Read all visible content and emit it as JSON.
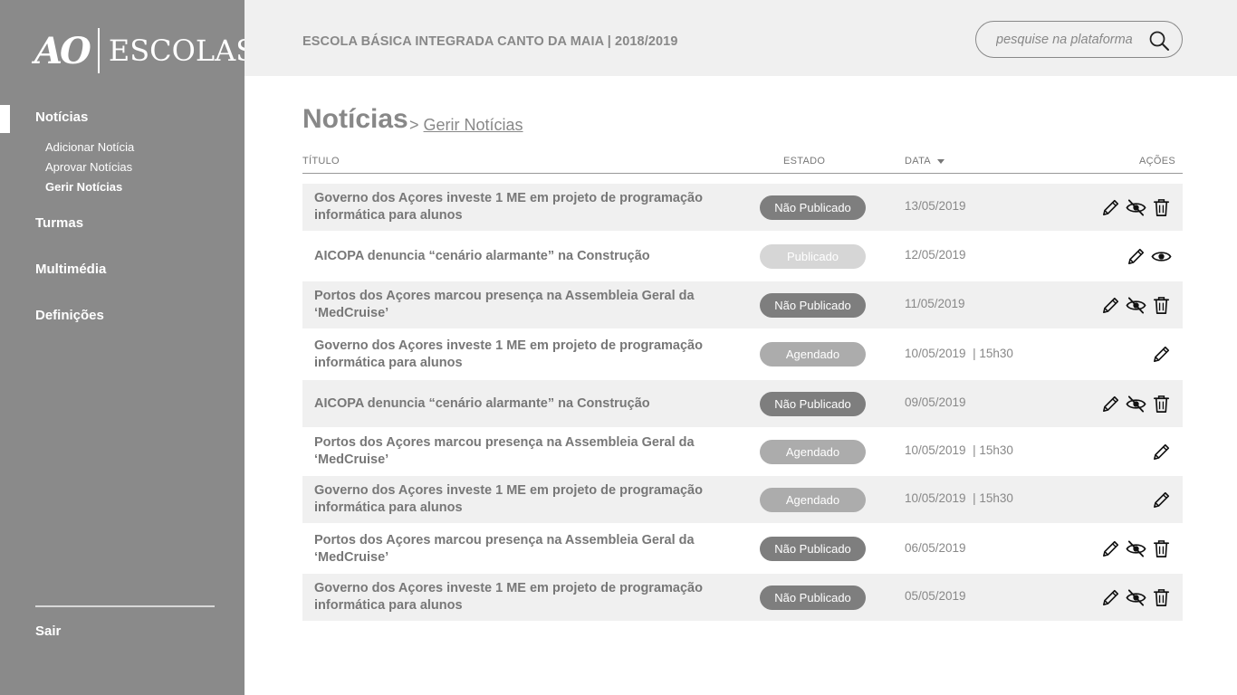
{
  "sidebar": {
    "logo_left": "AO",
    "logo_right": "ESCOLAS",
    "sections": [
      {
        "label": "Notícias"
      },
      {
        "label": "Turmas"
      },
      {
        "label": "Multimédia"
      },
      {
        "label": "Definições"
      }
    ],
    "subitems": [
      {
        "label": "Adicionar Notícia"
      },
      {
        "label": "Aprovar Notícias"
      },
      {
        "label": "Gerir Notícias"
      }
    ],
    "logout": "Sair"
  },
  "header": {
    "school": "ESCOLA BÁSICA INTEGRADA CANTO DA MAIA  | 2018/2019",
    "search_placeholder": "pesquise na plataforma"
  },
  "main": {
    "title": "Notícias",
    "breadcrumb_sep": ">",
    "breadcrumb_link": "Gerir Notícias",
    "columns": {
      "title": "TÍTULO",
      "state": "ESTADO",
      "date": "DATA",
      "actions": "AÇÕES"
    },
    "rows": [
      {
        "title": "Governo dos Açores investe 1 ME em projeto de programação informática para alunos",
        "state": "Não Publicado",
        "date": "13/05/2019",
        "actions": [
          "edit",
          "hide",
          "delete"
        ]
      },
      {
        "title": "AICOPA denuncia “cenário alarmante” na Construção",
        "state": "Publicado",
        "date": "12/05/2019",
        "actions": [
          "edit",
          "view"
        ]
      },
      {
        "title": "Portos dos Açores marcou presença na Assembleia Geral da ‘MedCruise’",
        "state": "Não Publicado",
        "date": "11/05/2019",
        "actions": [
          "edit",
          "hide",
          "delete"
        ]
      },
      {
        "title": "Governo dos Açores investe 1 ME em projeto de programação informática para alunos",
        "state": "Agendado",
        "date": "10/05/2019  | 15h30",
        "actions": [
          "edit"
        ]
      },
      {
        "title": "AICOPA denuncia “cenário alarmante” na Construção",
        "state": "Não Publicado",
        "date": "09/05/2019",
        "actions": [
          "edit",
          "hide",
          "delete"
        ]
      },
      {
        "title": "Portos dos Açores marcou presença na Assembleia Geral da ‘MedCruise’",
        "state": "Agendado",
        "date": "10/05/2019  | 15h30",
        "actions": [
          "edit"
        ]
      },
      {
        "title": "Governo dos Açores investe 1 ME em projeto de programação informática para alunos",
        "state": "Agendado",
        "date": "10/05/2019  | 15h30",
        "actions": [
          "edit"
        ]
      },
      {
        "title": "Portos dos Açores marcou presença na Assembleia Geral da ‘MedCruise’",
        "state": "Não Publicado",
        "date": "06/05/2019",
        "actions": [
          "edit",
          "hide",
          "delete"
        ]
      },
      {
        "title": "Governo dos Açores investe 1 ME em projeto de programação informática para alunos",
        "state": "Não Publicado",
        "date": "05/05/2019",
        "actions": [
          "edit",
          "hide",
          "delete"
        ]
      }
    ]
  }
}
